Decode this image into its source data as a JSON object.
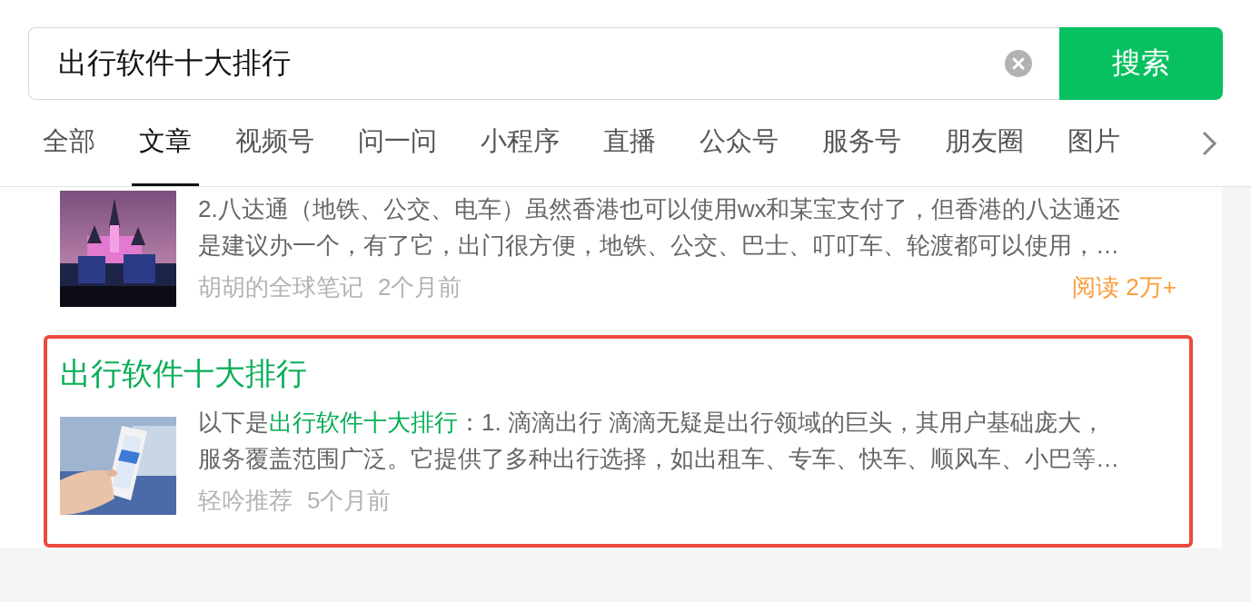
{
  "search": {
    "value": "出行软件十大排行",
    "button": "搜索"
  },
  "tabs": [
    {
      "label": "全部",
      "selected": false
    },
    {
      "label": "文章",
      "selected": true
    },
    {
      "label": "视频号",
      "selected": false
    },
    {
      "label": "问一问",
      "selected": false
    },
    {
      "label": "小程序",
      "selected": false
    },
    {
      "label": "直播",
      "selected": false
    },
    {
      "label": "公众号",
      "selected": false
    },
    {
      "label": "服务号",
      "selected": false
    },
    {
      "label": "朋友圈",
      "selected": false
    },
    {
      "label": "图片",
      "selected": false
    }
  ],
  "results": [
    {
      "highlighted": false,
      "thumbnail": {
        "kind": "picture"
      },
      "snippet_lines": [
        [
          {
            "text": "2.八达通（地铁、公交、电车）虽然香港也可以使用wx和某宝支付了，但香港的八达通还",
            "highlight": false
          }
        ],
        [
          {
            "text": "是建议办一个，有了它，出门很方便，地铁、公交、巴士、叮叮车、轮渡都可以使用，…",
            "highlight": false
          }
        ]
      ],
      "source": "胡胡的全球笔记",
      "time": "2个月前",
      "reads": "阅读 2万+"
    },
    {
      "highlighted": true,
      "thumbnail": {
        "kind": "picture"
      },
      "title": [
        {
          "text": "出行软件十大排行",
          "highlight": true
        }
      ],
      "snippet_lines": [
        [
          {
            "text": "以下是",
            "highlight": false
          },
          {
            "text": "出行软件十大排行",
            "highlight": true
          },
          {
            "text": "：1. 滴滴出行 滴滴无疑是出行领域的巨头，其用户基础庞大，",
            "highlight": false
          }
        ],
        [
          {
            "text": "服务覆盖范围广泛。它提供了多种出行选择，如出租车、专车、快车、顺风车、小巴等…",
            "highlight": false
          }
        ]
      ],
      "source": "轻吟推荐",
      "time": "5个月前"
    }
  ]
}
